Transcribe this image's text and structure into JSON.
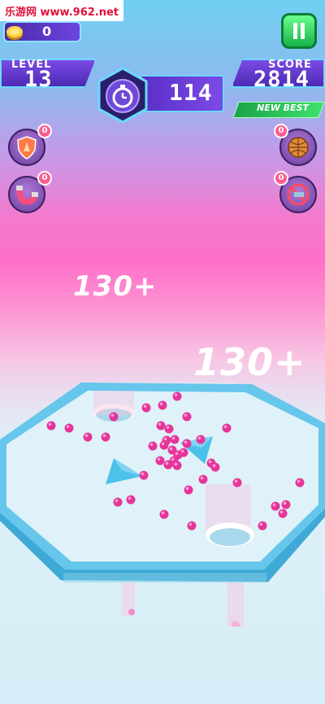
{
  "watermark": "乐游网 www.962.net",
  "coins": {
    "value": "0"
  },
  "hud": {
    "level_label": "LEVEL",
    "level_value": "13",
    "timer_value": "114",
    "score_label": "SCORE",
    "score_value": "2814",
    "new_best_label": "NEW BEST"
  },
  "powerups": {
    "left": [
      {
        "icon": "shield-icon",
        "count": "0"
      },
      {
        "icon": "magnet-icon",
        "count": "0"
      }
    ],
    "right": [
      {
        "icon": "ball-icon",
        "count": "0"
      },
      {
        "icon": "no-obstacle-icon",
        "count": "0"
      }
    ]
  },
  "floating_scores": [
    "130+",
    "130+"
  ],
  "colors": {
    "ball": "#e6359a",
    "board": "#5bc2e8",
    "surface": "#dff2f9"
  }
}
